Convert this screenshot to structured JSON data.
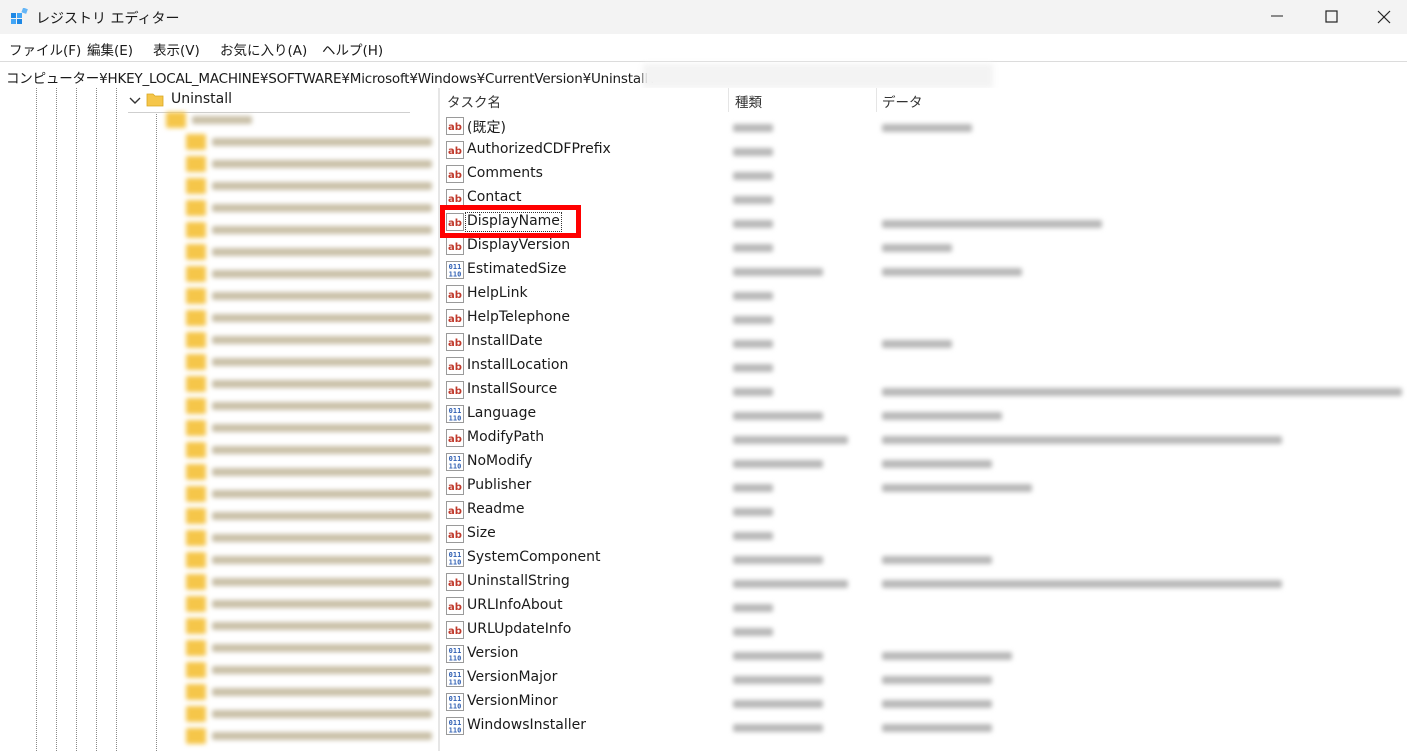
{
  "window": {
    "title": "レジストリ エディター"
  },
  "menu": [
    {
      "label": "ファイル(F)"
    },
    {
      "label": "編集(E)"
    },
    {
      "label": "表示(V)"
    },
    {
      "label": "お気に入り(A)"
    },
    {
      "label": "ヘルプ(H)"
    }
  ],
  "address": {
    "path": "コンピューター¥HKEY_LOCAL_MACHINE¥SOFTWARE¥Microsoft¥Windows¥CurrentVersion¥Uninstall¥"
  },
  "tree": {
    "selected_key": "Uninstall"
  },
  "columns": {
    "name": "タスク名",
    "type": "種類",
    "data": "データ"
  },
  "values": [
    {
      "name": "(既定)",
      "kind": "string"
    },
    {
      "name": "AuthorizedCDFPrefix",
      "kind": "string"
    },
    {
      "name": "Comments",
      "kind": "string"
    },
    {
      "name": "Contact",
      "kind": "string"
    },
    {
      "name": "DisplayName",
      "kind": "string"
    },
    {
      "name": "DisplayVersion",
      "kind": "string"
    },
    {
      "name": "EstimatedSize",
      "kind": "dword"
    },
    {
      "name": "HelpLink",
      "kind": "string"
    },
    {
      "name": "HelpTelephone",
      "kind": "string"
    },
    {
      "name": "InstallDate",
      "kind": "string"
    },
    {
      "name": "InstallLocation",
      "kind": "string"
    },
    {
      "name": "InstallSource",
      "kind": "string"
    },
    {
      "name": "Language",
      "kind": "dword"
    },
    {
      "name": "ModifyPath",
      "kind": "string"
    },
    {
      "name": "NoModify",
      "kind": "dword"
    },
    {
      "name": "Publisher",
      "kind": "string"
    },
    {
      "name": "Readme",
      "kind": "string"
    },
    {
      "name": "Size",
      "kind": "string"
    },
    {
      "name": "SystemComponent",
      "kind": "dword"
    },
    {
      "name": "UninstallString",
      "kind": "string"
    },
    {
      "name": "URLInfoAbout",
      "kind": "string"
    },
    {
      "name": "URLUpdateInfo",
      "kind": "string"
    },
    {
      "name": "Version",
      "kind": "dword"
    },
    {
      "name": "VersionMajor",
      "kind": "dword"
    },
    {
      "name": "VersionMinor",
      "kind": "dword"
    },
    {
      "name": "WindowsInstaller",
      "kind": "dword"
    }
  ],
  "highlight": {
    "target": "DisplayName",
    "color": "#ff0000"
  },
  "colors": {
    "folder": "#f5c64a",
    "string_icon": "#c0392b",
    "dword_icon": "#2f5fb3"
  }
}
